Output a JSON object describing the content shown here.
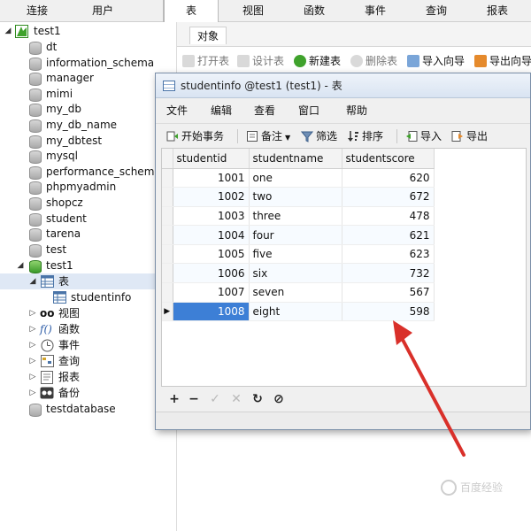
{
  "top_tabs": {
    "connect": "连接",
    "user": "用户",
    "table": "表",
    "view": "视图",
    "function": "函数",
    "event": "事件",
    "query": "查询",
    "report": "报表"
  },
  "tree": {
    "connection": "test1",
    "databases": [
      "dt",
      "information_schema",
      "manager",
      "mimi",
      "my_db",
      "my_db_name",
      "my_dbtest",
      "mysql",
      "performance_schema",
      "phpmyadmin",
      "shopcz",
      "student",
      "tarena",
      "test"
    ],
    "open_db": "test1",
    "tables_node": "表",
    "table_item": "studentinfo",
    "view_node": "视图",
    "function_node": "函数",
    "event_node": "事件",
    "query_node": "查询",
    "report_node": "报表",
    "backup_node": "备份",
    "last_db": "testdatabase"
  },
  "main": {
    "object_tab": "对象",
    "toolbar": {
      "open_table": "打开表",
      "design_table": "设计表",
      "new_table": "新建表",
      "delete_table": "删除表",
      "import_wizard": "导入向导",
      "export_wizard": "导出向导"
    }
  },
  "window": {
    "title": "studentinfo @test1 (test1) - 表",
    "menu": {
      "file": "文件",
      "edit": "编辑",
      "view": "查看",
      "window": "窗口",
      "help": "帮助"
    },
    "toolbar": {
      "begin_transaction": "开始事务",
      "memo": "备注",
      "filter": "筛选",
      "sort": "排序",
      "import": "导入",
      "export": "导出"
    },
    "grid": {
      "columns": [
        "studentid",
        "studentname",
        "studentscore"
      ],
      "rows": [
        [
          "1001",
          "one",
          "620"
        ],
        [
          "1002",
          "two",
          "672"
        ],
        [
          "1003",
          "three",
          "478"
        ],
        [
          "1004",
          "four",
          "621"
        ],
        [
          "1005",
          "five",
          "623"
        ],
        [
          "1006",
          "six",
          "732"
        ],
        [
          "1007",
          "seven",
          "567"
        ],
        [
          "1008",
          "eight",
          "598"
        ]
      ],
      "current_row_marker": "▶"
    },
    "nav": {
      "add": "+",
      "remove": "−",
      "apply": "✓",
      "cancel": "✕",
      "refresh": "↻",
      "stop": "⊘"
    }
  },
  "colors": {
    "selection": "#3d7fd6",
    "annotation_arrow": "#d9302a"
  },
  "watermark": {
    "title": "百度经验"
  }
}
